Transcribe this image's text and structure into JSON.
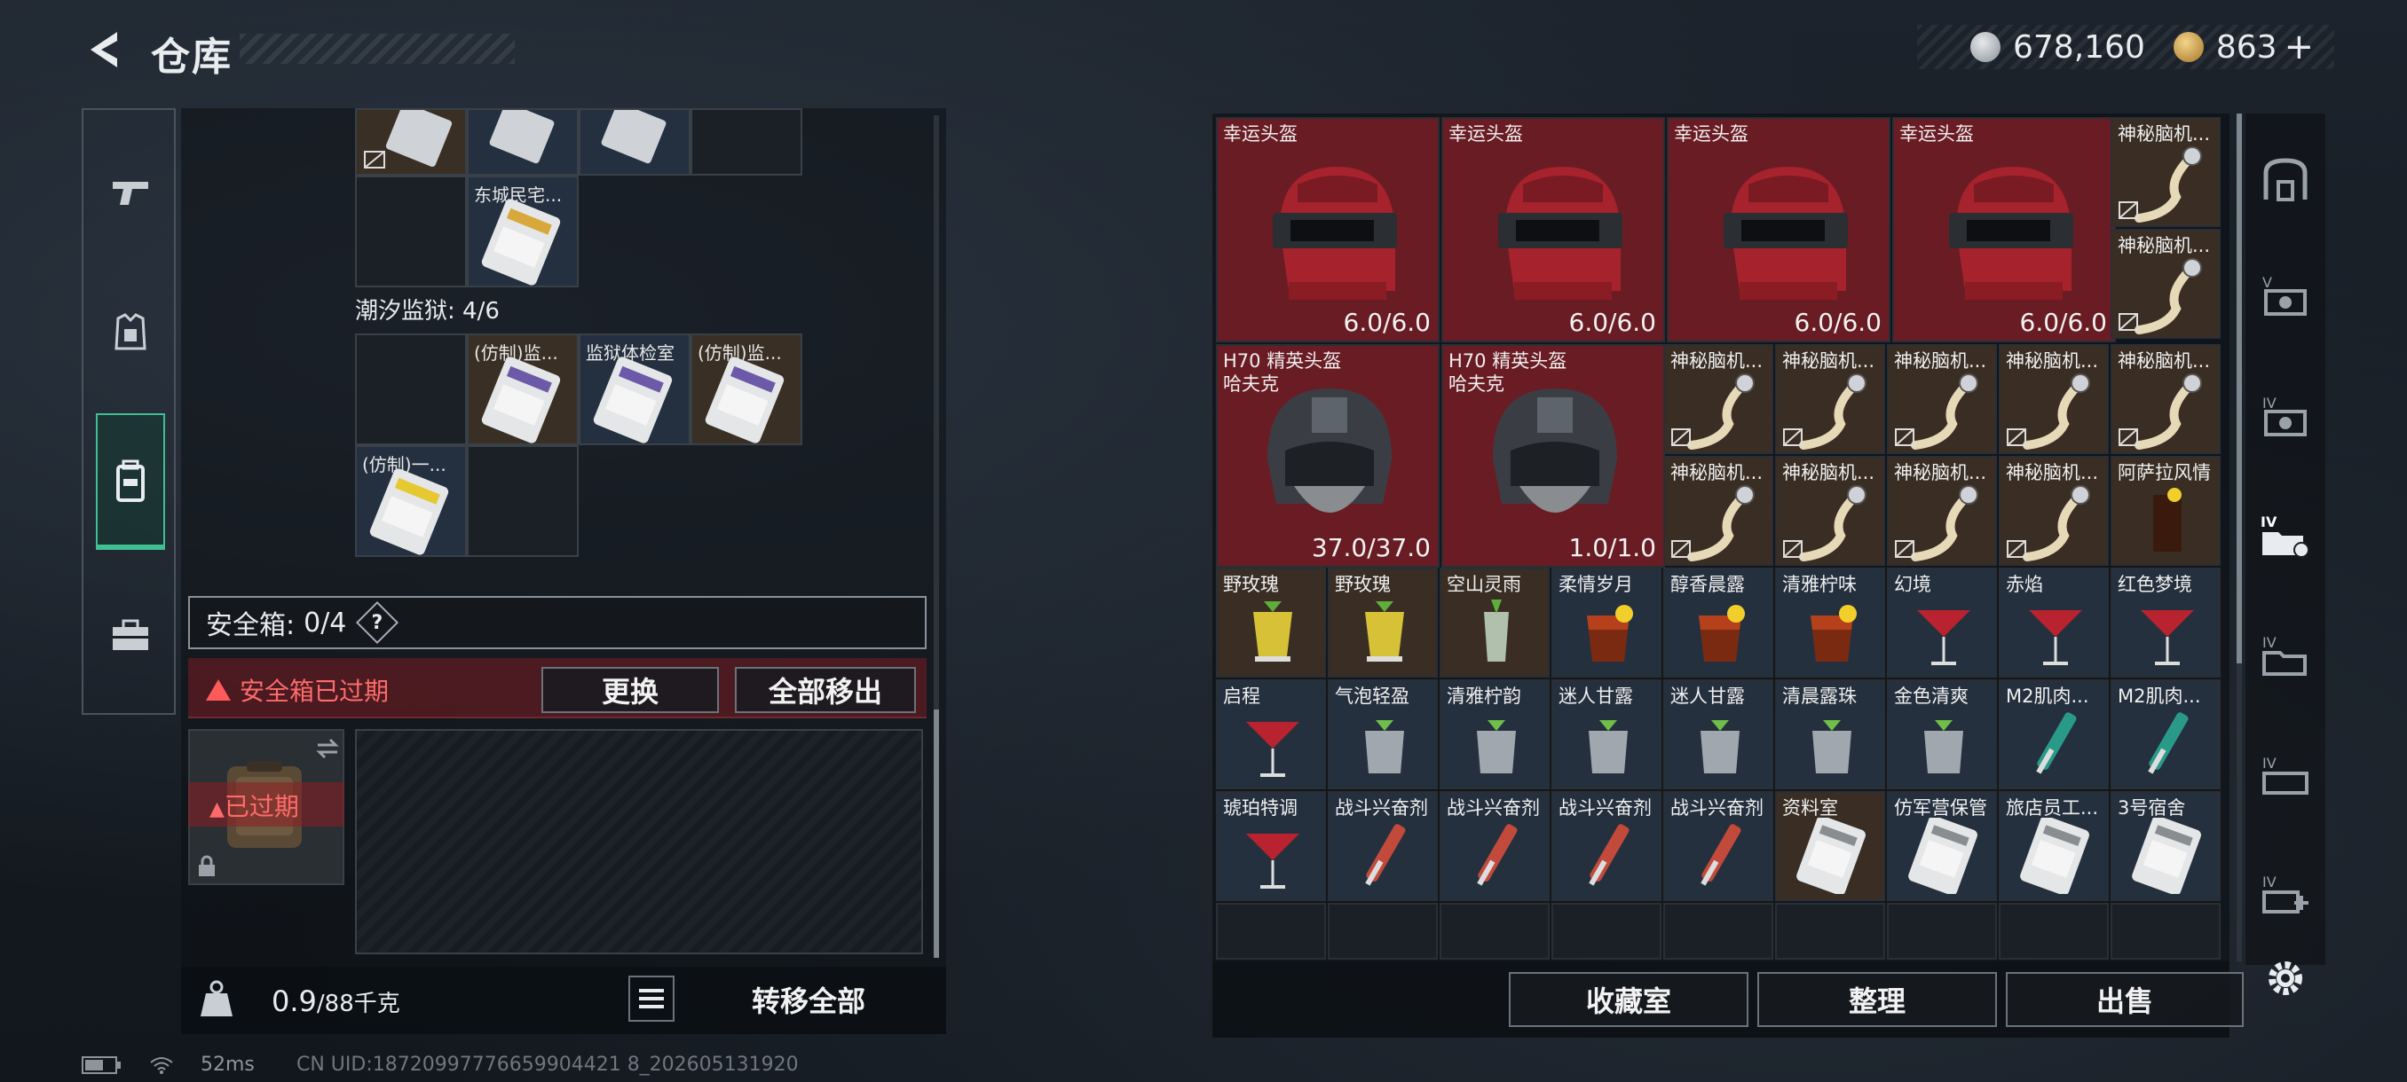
{
  "header": {
    "title": "仓库"
  },
  "currency": {
    "silver": "678,160",
    "gold": "863",
    "plus": "+"
  },
  "left_panel": {
    "top_cells": [
      {
        "label": ""
      },
      {
        "label": ""
      },
      {
        "label": ""
      },
      {
        "label": ""
      }
    ],
    "dongcheng_cell": {
      "label": "东城民宅..."
    },
    "tide_prison": {
      "title": "潮汐监狱: 4/6",
      "cells": [
        {
          "label": ""
        },
        {
          "label": "(仿制)监..."
        },
        {
          "label": "监狱体检室"
        },
        {
          "label": "(仿制)监..."
        },
        {
          "label": "(仿制)一..."
        },
        {
          "label": ""
        }
      ]
    },
    "safe_box": {
      "label": "安全箱:",
      "count": "0/4",
      "help": "?"
    },
    "warning": {
      "text": "安全箱已过期",
      "replace_btn": "更换",
      "move_all_btn": "全部移出",
      "expired_label": "已过期"
    },
    "weight": {
      "current": "0.9",
      "max": "/88千克"
    },
    "transfer_all_btn": "转移全部"
  },
  "right_panel": {
    "helmets_lucky": [
      {
        "label": "幸运头盔",
        "durability": "6.0/6.0"
      },
      {
        "label": "幸运头盔",
        "durability": "6.0/6.0"
      },
      {
        "label": "幸运头盔",
        "durability": "6.0/6.0"
      },
      {
        "label": "幸运头盔",
        "durability": "6.0/6.0"
      }
    ],
    "helmets_h70": [
      {
        "label": "H70 精英头盔",
        "sub": "哈夫克",
        "durability": "37.0/37.0"
      },
      {
        "label": "H70 精英头盔",
        "sub": "哈夫克",
        "durability": "1.0/1.0"
      }
    ],
    "small_items": [
      "神秘脑机...",
      "神秘脑机...",
      "神秘脑机...",
      "神秘脑机...",
      "神秘脑机...",
      "神秘脑机...",
      "神秘脑机...",
      "神秘脑机...",
      "神秘脑机...",
      "神秘脑机...",
      "神秘脑机...",
      "阿萨拉风情"
    ],
    "row3": [
      "野玫瑰",
      "野玫瑰",
      "空山灵雨",
      "柔情岁月",
      "醇香晨露",
      "清雅柠味",
      "幻境",
      "赤焰",
      "红色梦境"
    ],
    "row4": [
      "启程",
      "气泡轻盈",
      "清雅柠韵",
      "迷人甘露",
      "迷人甘露",
      "清晨露珠",
      "金色清爽",
      "M2肌肉...",
      "M2肌肉..."
    ],
    "row5": [
      "琥珀特调",
      "战斗兴奋剂",
      "战斗兴奋剂",
      "战斗兴奋剂",
      "战斗兴奋剂",
      "资料室",
      "仿军营保管",
      "旅店员工...",
      "3号宿舍"
    ],
    "footer_buttons": {
      "collection": "收藏室",
      "organize": "整理",
      "sell": "出售"
    }
  },
  "status": {
    "ping": "52ms",
    "uid": "CN UID:18720997776659904421 8_202605131920"
  },
  "colors": {
    "accent": "#3fbf93",
    "warning": "#ff5a5a",
    "red_cell": "#6a1c24"
  }
}
